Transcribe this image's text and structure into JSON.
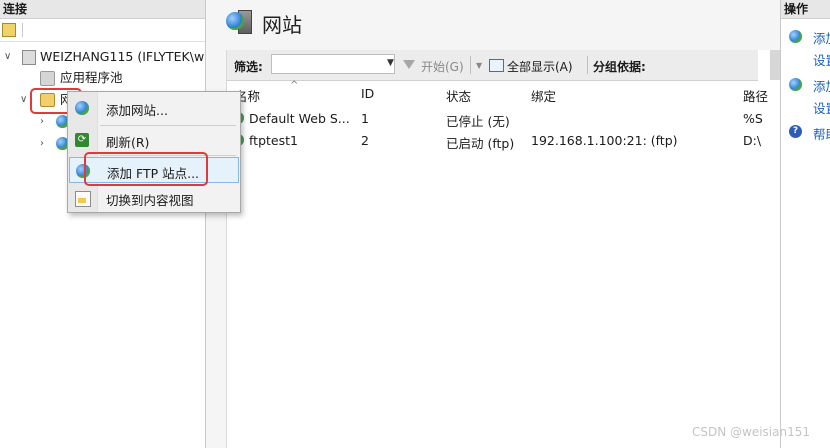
{
  "left_pane": {
    "header": "连接",
    "tree": {
      "server": "WEIZHANG115 (IFLYTEK\\w",
      "app_pools": "应用程序池",
      "sites": "网站"
    }
  },
  "context_menu": {
    "items": [
      {
        "label": "添加网站..."
      },
      {
        "label": "刷新(R)"
      },
      {
        "label": "添加 FTP 站点..."
      },
      {
        "label": "切换到内容视图"
      }
    ]
  },
  "center_pane": {
    "title": "网站",
    "filter": {
      "label": "筛选:",
      "value": "",
      "start": "开始(G)",
      "show_all": "全部显示(A)",
      "group_by": "分组依据:"
    },
    "columns": [
      "名称",
      "ID",
      "状态",
      "绑定",
      "路径"
    ],
    "rows": [
      {
        "name": "Default Web S...",
        "id": "1",
        "status": "已停止 (无)",
        "binding": "",
        "path": "%S"
      },
      {
        "name": "ftptest1",
        "id": "2",
        "status": "已启动 (ftp)",
        "binding": "192.168.1.100:21: (ftp)",
        "path": "D:\\"
      }
    ]
  },
  "right_pane": {
    "header": "操作",
    "actions": [
      {
        "line1": "添加",
        "line2": "设置"
      },
      {
        "line1": "添加",
        "line2": "设置"
      },
      {
        "line1": "帮助"
      }
    ]
  },
  "watermark": "CSDN @weisian151",
  "colors": {
    "highlight_box": "#e0393e",
    "link": "#1c5fb8",
    "menu_hover": "#e5f1fb"
  }
}
